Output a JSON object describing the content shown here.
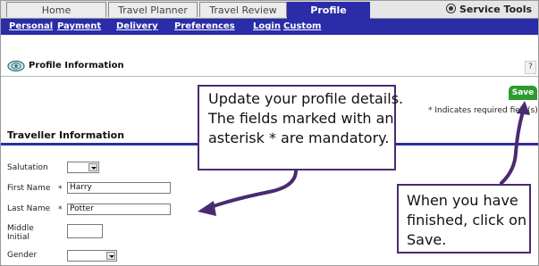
{
  "tabs": {
    "home": "Home",
    "travel_planner": "Travel Planner",
    "travel_review": "Travel Review",
    "profile": "Profile"
  },
  "service_tools": "Service Tools",
  "subnav": {
    "personal": "Personal",
    "payment": "Payment",
    "delivery": "Delivery",
    "preferences": "Preferences",
    "login": "Login",
    "custom": "Custom"
  },
  "section": {
    "profile_title": "Profile Information",
    "help": "?",
    "save": "Save",
    "required_note": "* Indicates required field(s)",
    "traveller_title": "Traveller Information"
  },
  "form": {
    "salutation_label": "Salutation",
    "first_name_label": "First Name",
    "first_name_value": "Harry",
    "last_name_label": "Last Name",
    "last_name_value": "Potter",
    "middle_initial_label_line1": "Middle",
    "middle_initial_label_line2": "Initial",
    "gender_label": "Gender",
    "required_mark": "*"
  },
  "callouts": {
    "update": {
      "line1": "Update your profile details.",
      "line2": "The fields marked with an",
      "line3": "asterisk * are mandatory."
    },
    "save": {
      "line1": "When you have",
      "line2": "finished, click on",
      "line3": "Save."
    }
  },
  "colors": {
    "nav_blue": "#2a2ca8",
    "save_green": "#2e9b2e",
    "callout_purple": "#4a2a70"
  }
}
